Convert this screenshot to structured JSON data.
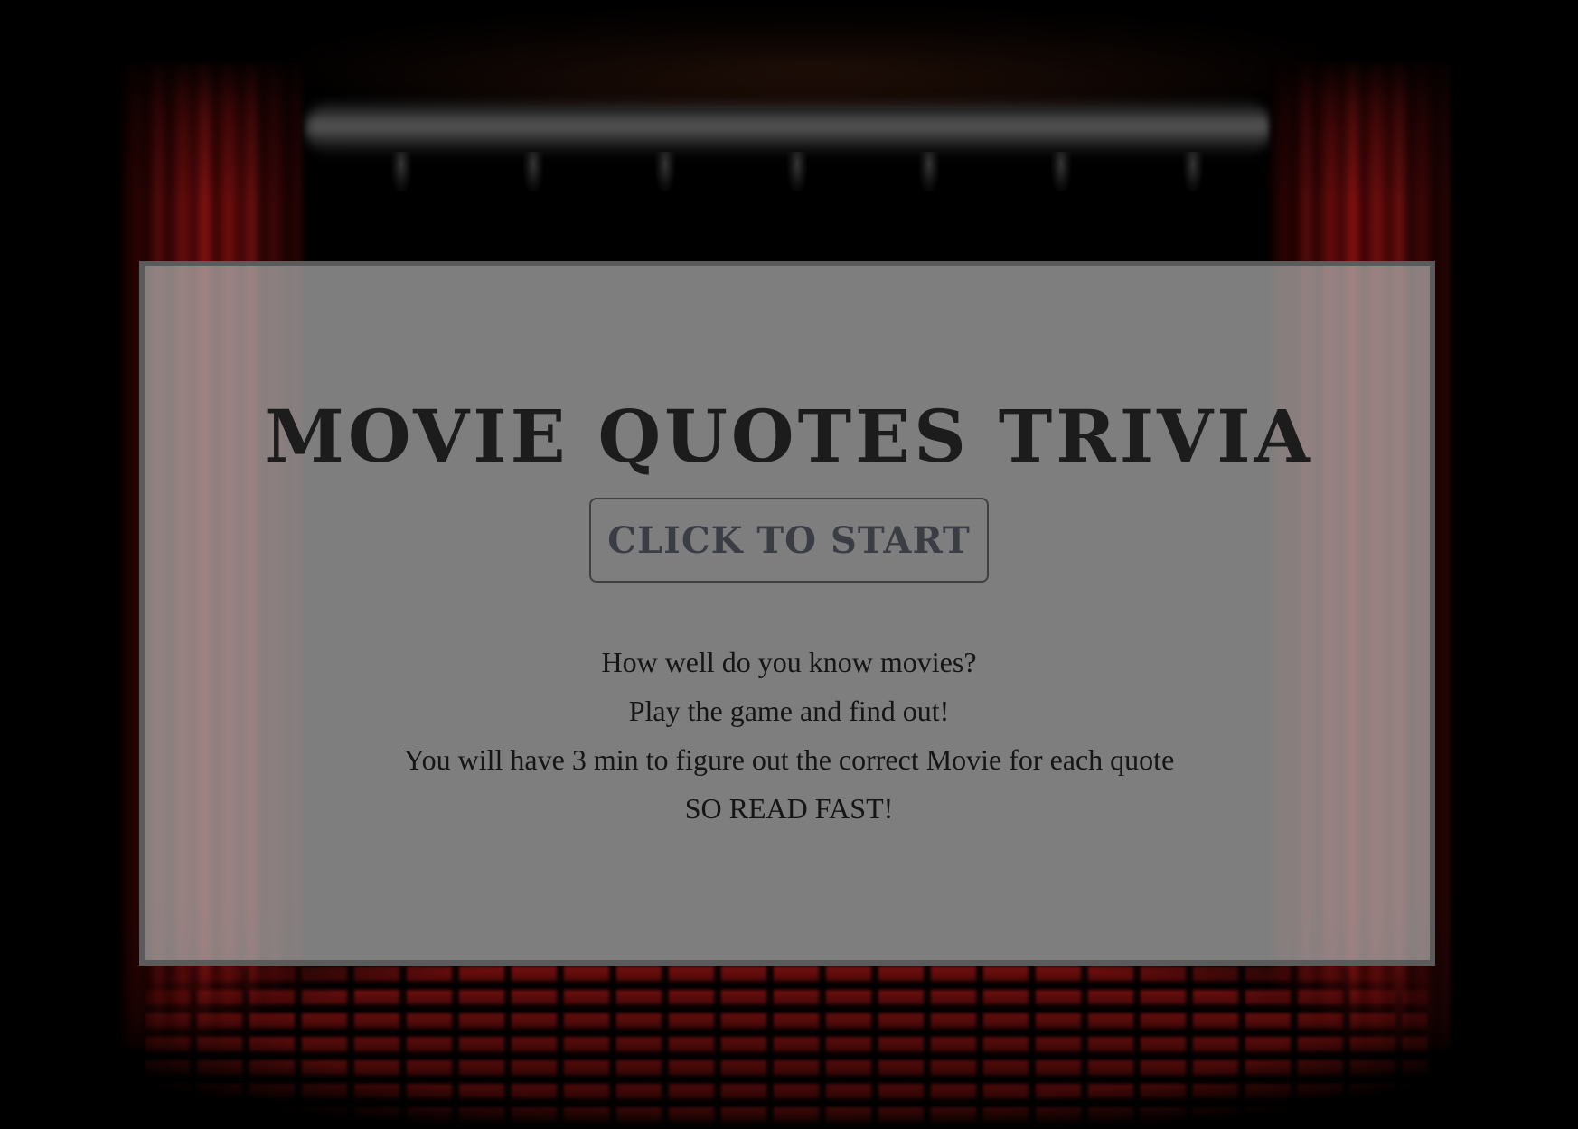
{
  "game": {
    "title": "MOVIE QUOTES TRIVIA",
    "start_button_label": "CLICK TO START",
    "intro_lines": [
      "How well do you know movies?",
      "Play the game and find out!",
      "You will have 3 min to figure out the correct Movie for each quote",
      "SO READ FAST!"
    ]
  },
  "colors": {
    "panel_background": "#afafaf",
    "panel_border": "#5b5b5b",
    "curtain": "#8a1010",
    "text": "#151515"
  }
}
